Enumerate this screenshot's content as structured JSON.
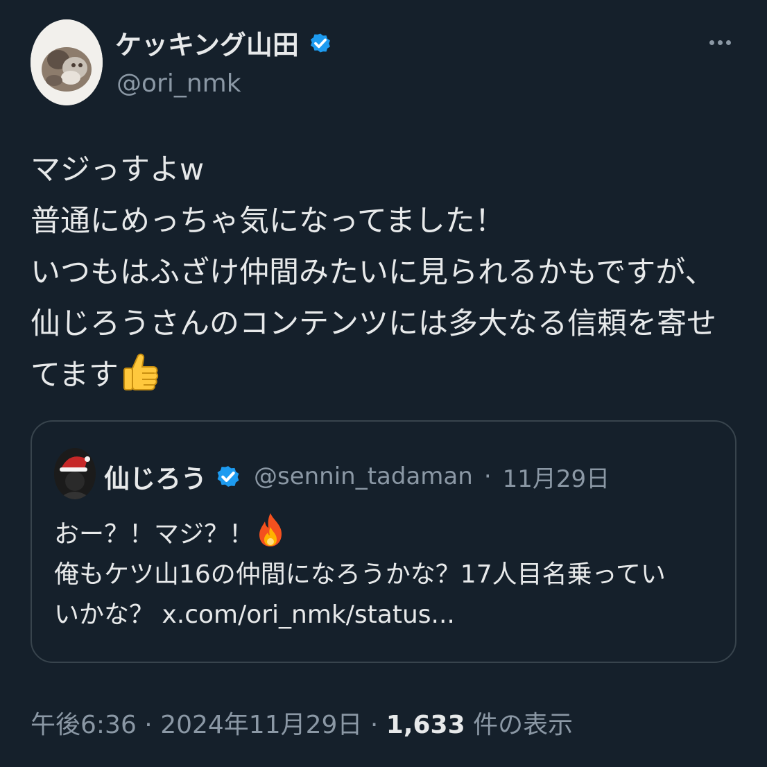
{
  "author": {
    "display_name": "ケッキング山田",
    "handle": "@ori_nmk"
  },
  "tweet": {
    "lines": [
      "マジっすよw",
      "普通にめっちゃ気になってました！",
      "いつもはふざけ仲間みたいに見られるかもですが、",
      "仙じろうさんのコンテンツには多大なる信頼を寄せ",
      "てます"
    ]
  },
  "quote": {
    "display_name": "仙じろう",
    "handle": "@sennin_tadaman",
    "separator": "·",
    "date": "11月29日",
    "line1": "おー？！マジ？！",
    "line2": "俺もケツ山16の仲間になろうかな？17人目名乗ってい",
    "line3_text": "いかな？ ",
    "line3_link": "x.com/ori_nmk/status..."
  },
  "footer": {
    "time": "午後6:36",
    "separator1": " · ",
    "date": "2024年11月29日",
    "separator2": " · ",
    "view_count": "1,633",
    "view_label": " 件の表示"
  },
  "icons": {
    "more": "more-horizontal-icon",
    "verified": "verified-badge-icon",
    "thumbs_up": "thumbs-up-emoji",
    "fire": "fire-emoji"
  },
  "colors": {
    "background": "#15202b",
    "text_primary": "#e7e9ea",
    "text_secondary": "#8b98a5",
    "border": "#38444d",
    "verified_blue": "#1d9bf0"
  }
}
